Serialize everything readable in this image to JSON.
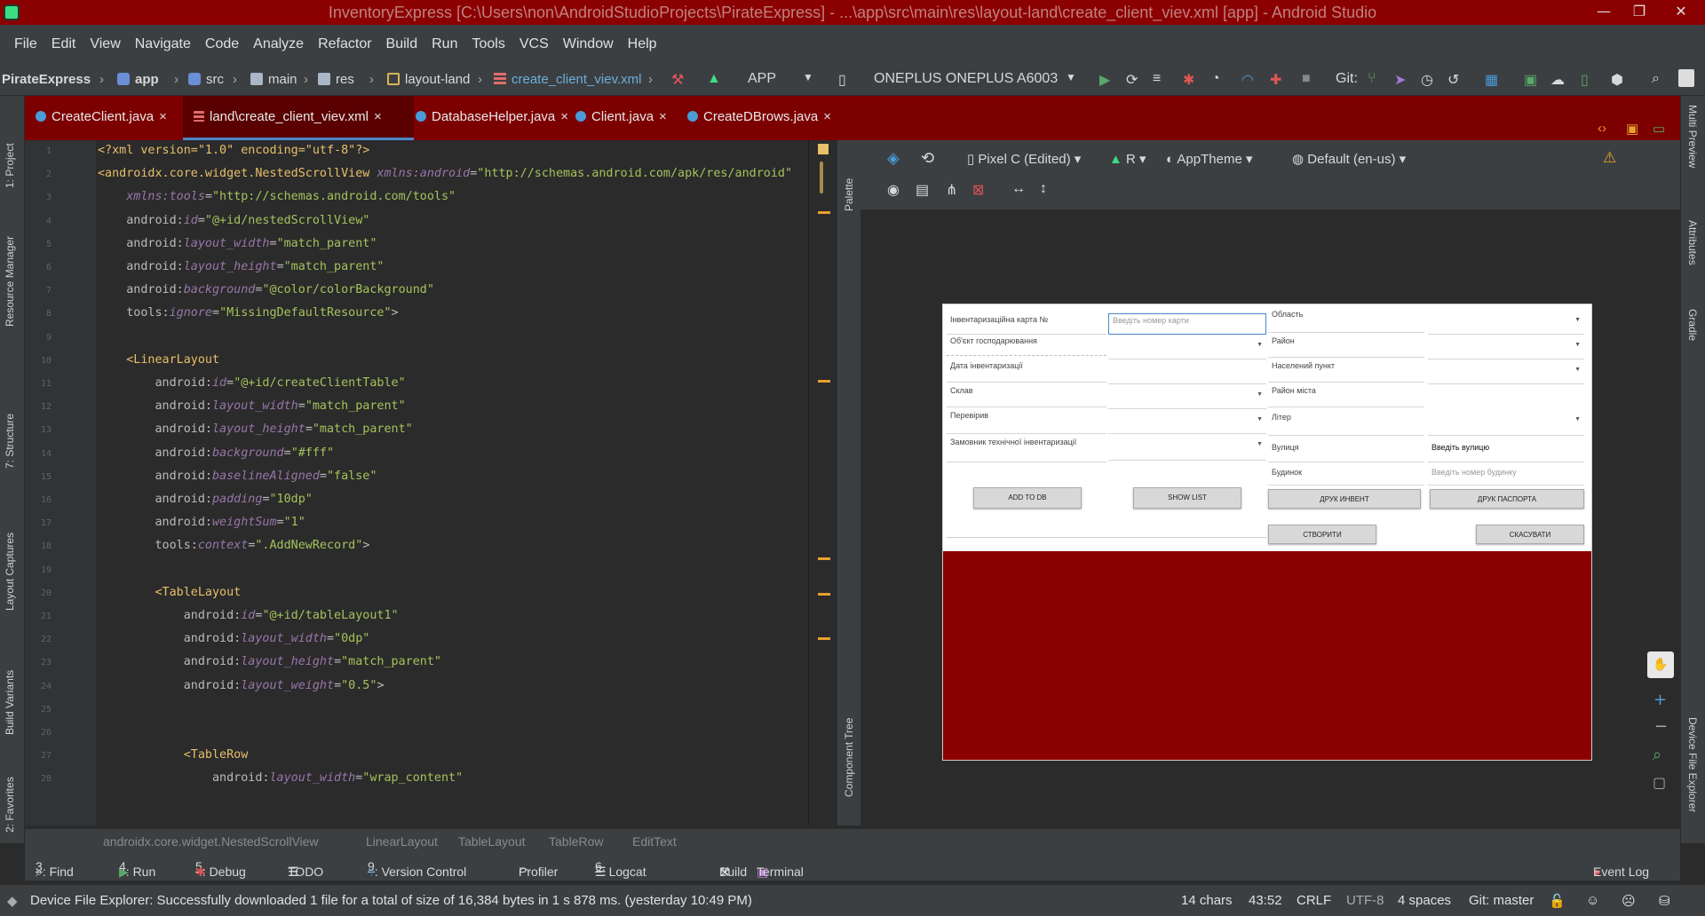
{
  "window": {
    "title": "InventoryExpress [C:\\Users\\non\\AndroidStudioProjects\\PirateExpress] - ...\\app\\src\\main\\res\\layout-land\\create_client_viev.xml [app] - Android Studio",
    "minimize": "—",
    "maximize": "❐",
    "close": "✕"
  },
  "menu": [
    "File",
    "Edit",
    "View",
    "Navigate",
    "Code",
    "Analyze",
    "Refactor",
    "Build",
    "Run",
    "Tools",
    "VCS",
    "Window",
    "Help"
  ],
  "breadcrumb": {
    "project": "PirateExpress",
    "items": [
      "app",
      "src",
      "main",
      "res",
      "layout-land",
      "create_client_viev.xml"
    ],
    "run_config": "APP",
    "device": "ONEPLUS ONEPLUS A6003",
    "git_label": "Git:"
  },
  "tabs": [
    {
      "label": "CreateClient.java"
    },
    {
      "label": "land\\create_client_viev.xml"
    },
    {
      "label": "DatabaseHelper.java"
    },
    {
      "label": "Client.java"
    },
    {
      "label": "CreateDBrows.java"
    }
  ],
  "left_tools": [
    "1: Project",
    "Resource Manager",
    "7: Structure",
    "Layout Captures",
    "Build Variants",
    "2: Favorites"
  ],
  "right_tools": [
    "Multi Preview",
    "Attributes",
    "Gradle",
    "Device File Explorer"
  ],
  "code_lines": [
    {
      "n": "1",
      "parts": [
        [
          "pi",
          "<?xml version=\"1.0\" encoding=\"utf-8\"?>"
        ]
      ]
    },
    {
      "n": "2",
      "parts": [
        [
          "tag",
          "<androidx.core.widget.NestedScrollView "
        ],
        [
          "ns",
          "xmlns:android"
        ],
        [
          "attr",
          "="
        ],
        [
          "val",
          "\"http://schemas.android.com/apk/res/android\""
        ]
      ]
    },
    {
      "n": "3",
      "parts": [
        [
          "attr",
          "    "
        ],
        [
          "ns",
          "xmlns:tools"
        ],
        [
          "attr",
          "="
        ],
        [
          "val",
          "\"http://schemas.android.com/tools\""
        ]
      ]
    },
    {
      "n": "4",
      "parts": [
        [
          "attr",
          "    android:"
        ],
        [
          "ns",
          "id"
        ],
        [
          "attr",
          "="
        ],
        [
          "val",
          "\"@+id/nestedScrollView\""
        ]
      ]
    },
    {
      "n": "5",
      "parts": [
        [
          "attr",
          "    android:"
        ],
        [
          "ns",
          "layout_width"
        ],
        [
          "attr",
          "="
        ],
        [
          "val",
          "\"match_parent\""
        ]
      ]
    },
    {
      "n": "6",
      "parts": [
        [
          "attr",
          "    android:"
        ],
        [
          "ns",
          "layout_height"
        ],
        [
          "attr",
          "="
        ],
        [
          "val",
          "\"match_parent\""
        ]
      ]
    },
    {
      "n": "7",
      "parts": [
        [
          "attr",
          "    android:"
        ],
        [
          "ns",
          "background"
        ],
        [
          "attr",
          "="
        ],
        [
          "val",
          "\"@color/colorBackground\""
        ]
      ]
    },
    {
      "n": "8",
      "parts": [
        [
          "attr",
          "    tools:"
        ],
        [
          "ns",
          "ignore"
        ],
        [
          "attr",
          "="
        ],
        [
          "val",
          "\"MissingDefaultResource\""
        ],
        [
          "attr",
          ">"
        ]
      ]
    },
    {
      "n": "9",
      "parts": []
    },
    {
      "n": "10",
      "parts": [
        [
          "tag",
          "    <LinearLayout"
        ]
      ]
    },
    {
      "n": "11",
      "parts": [
        [
          "attr",
          "        android:"
        ],
        [
          "ns",
          "id"
        ],
        [
          "attr",
          "="
        ],
        [
          "val",
          "\"@+id/createClientTable\""
        ]
      ]
    },
    {
      "n": "12",
      "parts": [
        [
          "attr",
          "        android:"
        ],
        [
          "ns",
          "layout_width"
        ],
        [
          "attr",
          "="
        ],
        [
          "val",
          "\"match_parent\""
        ]
      ]
    },
    {
      "n": "13",
      "parts": [
        [
          "attr",
          "        android:"
        ],
        [
          "ns",
          "layout_height"
        ],
        [
          "attr",
          "="
        ],
        [
          "val",
          "\"match_parent\""
        ]
      ]
    },
    {
      "n": "14",
      "parts": [
        [
          "attr",
          "        android:"
        ],
        [
          "ns",
          "background"
        ],
        [
          "attr",
          "="
        ],
        [
          "val",
          "\"#fff\""
        ]
      ]
    },
    {
      "n": "15",
      "parts": [
        [
          "attr",
          "        android:"
        ],
        [
          "ns",
          "baselineAligned"
        ],
        [
          "attr",
          "="
        ],
        [
          "val",
          "\"false\""
        ]
      ]
    },
    {
      "n": "16",
      "parts": [
        [
          "attr",
          "        android:"
        ],
        [
          "ns",
          "padding"
        ],
        [
          "attr",
          "="
        ],
        [
          "val",
          "\"10dp\""
        ]
      ]
    },
    {
      "n": "17",
      "parts": [
        [
          "attr",
          "        android:"
        ],
        [
          "ns",
          "weightSum"
        ],
        [
          "attr",
          "="
        ],
        [
          "val",
          "\"1\""
        ]
      ]
    },
    {
      "n": "18",
      "parts": [
        [
          "attr",
          "        tools:"
        ],
        [
          "ns",
          "context"
        ],
        [
          "attr",
          "="
        ],
        [
          "val",
          "\".AddNewRecord\""
        ],
        [
          "attr",
          ">"
        ]
      ]
    },
    {
      "n": "19",
      "parts": []
    },
    {
      "n": "20",
      "parts": [
        [
          "tag",
          "        <TableLayout"
        ]
      ]
    },
    {
      "n": "21",
      "parts": [
        [
          "attr",
          "            android:"
        ],
        [
          "ns",
          "id"
        ],
        [
          "attr",
          "="
        ],
        [
          "val",
          "\"@+id/tableLayout1\""
        ]
      ]
    },
    {
      "n": "22",
      "parts": [
        [
          "attr",
          "            android:"
        ],
        [
          "ns",
          "layout_width"
        ],
        [
          "attr",
          "="
        ],
        [
          "val",
          "\"0dp\""
        ]
      ]
    },
    {
      "n": "23",
      "parts": [
        [
          "attr",
          "            android:"
        ],
        [
          "ns",
          "layout_height"
        ],
        [
          "attr",
          "="
        ],
        [
          "val",
          "\"match_parent\""
        ]
      ]
    },
    {
      "n": "24",
      "parts": [
        [
          "attr",
          "            android:"
        ],
        [
          "ns",
          "layout_weight"
        ],
        [
          "attr",
          "="
        ],
        [
          "val",
          "\"0.5\""
        ],
        [
          "attr",
          ">"
        ]
      ]
    },
    {
      "n": "25",
      "parts": []
    },
    {
      "n": "26",
      "parts": []
    },
    {
      "n": "27",
      "parts": [
        [
          "tag",
          "            <TableRow"
        ]
      ]
    },
    {
      "n": "28",
      "parts": [
        [
          "attr",
          "                android:"
        ],
        [
          "ns",
          "layout_width"
        ],
        [
          "attr",
          "="
        ],
        [
          "val",
          "\"wrap_content\""
        ]
      ]
    }
  ],
  "design_toolbar": {
    "device": "Pixel C (Edited)",
    "api": "R",
    "theme": "AppTheme",
    "locale": "Default (en-us)",
    "palette_label": "Palette",
    "component_tree_label": "Component Tree"
  },
  "form": {
    "left_labels": [
      "Інвентаризаційна карта №",
      "Об'єкт господарювання",
      "Дата інвентаризації",
      "Склав",
      "Перевірив",
      "Замовник технічної інвентаризації"
    ],
    "card_hint": "Введіть номер карти",
    "right_labels": [
      "Область",
      "Район",
      "Населений пункт",
      "Район міста",
      "Літер",
      "Вулиця",
      "Будинок"
    ],
    "street_value": "Введіть вулицю",
    "house_hint": "Введіть номер будинку",
    "btn_add": "ADD TO DB",
    "btn_show": "SHOW LIST",
    "btn_print_inv": "ДРУК ИНВЕНТ",
    "btn_print_pass": "ДРУК ПАСПОРТА",
    "btn_create": "СТВОРИТИ",
    "btn_cancel": "СКАСУВАТИ",
    "dropdown_glyph": "▼"
  },
  "path": [
    "androidx.core.widget.NestedScrollView",
    "LinearLayout",
    "TableLayout",
    "TableRow",
    "EditText"
  ],
  "bottom_tools": [
    {
      "num": "3",
      "label": ": Find"
    },
    {
      "num": "4",
      "label": ": Run"
    },
    {
      "num": "5",
      "label": ": Debug"
    },
    {
      "num": "",
      "label": "TODO"
    },
    {
      "num": "9",
      "label": ": Version Control"
    },
    {
      "num": "",
      "label": "Profiler"
    },
    {
      "num": "6",
      "label": ": Logcat"
    },
    {
      "num": "",
      "label": "Build"
    },
    {
      "num": "",
      "label": "Terminal"
    }
  ],
  "event_log": "Event Log",
  "status": {
    "message": "Device File Explorer: Successfully downloaded 1 file for a total of size of 16,384 bytes in 1 s 878 ms. (yesterday 10:49 PM)",
    "chars": "14 chars",
    "position": "43:52",
    "line_sep": "CRLF",
    "encoding": "UTF-8",
    "indent": "4 spaces",
    "git": "Git: master"
  },
  "colors": {
    "accent_red": "#8b0000",
    "tab_red": "#7d0000",
    "ide_dark": "#2b2b2b",
    "panel": "#3c3f41"
  }
}
